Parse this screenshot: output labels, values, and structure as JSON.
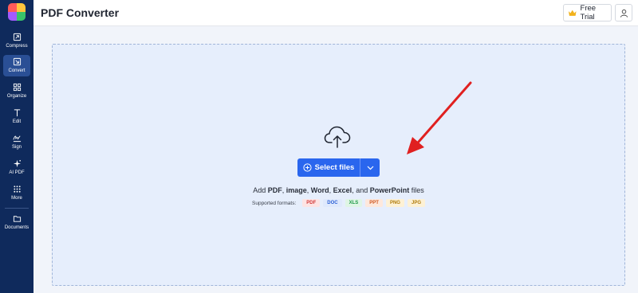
{
  "header": {
    "title": "PDF Converter",
    "free_trial_label": "Free Trial"
  },
  "sidebar": {
    "items": [
      {
        "label": "Compress",
        "icon": "compress-icon"
      },
      {
        "label": "Convert",
        "icon": "convert-icon",
        "active": true
      },
      {
        "label": "Organize",
        "icon": "organize-icon"
      },
      {
        "label": "Edit",
        "icon": "edit-text-icon"
      },
      {
        "label": "Sign",
        "icon": "signature-icon"
      },
      {
        "label": "AI PDF",
        "icon": "sparkle-icon"
      },
      {
        "label": "More",
        "icon": "grid-dots-icon"
      },
      {
        "label": "Documents",
        "icon": "folder-icon"
      }
    ]
  },
  "upload": {
    "select_label": "Select files",
    "description": {
      "prefix": "Add ",
      "pdf": "PDF",
      "sep1": ", ",
      "image": "image",
      "sep2": ", ",
      "word": "Word",
      "sep3": ", ",
      "excel": "Excel",
      "sep4": ", and ",
      "powerpoint": "PowerPoint",
      "suffix": " files"
    },
    "supported_label": "Supported formats:",
    "formats": [
      "PDF",
      "DOC",
      "XLS",
      "PPT",
      "PNG",
      "JPG"
    ]
  },
  "colors": {
    "sidebar": "#0f2a5c",
    "accent": "#2a66ee",
    "dropzone": "#e6eefc",
    "arrow": "#e02020"
  }
}
